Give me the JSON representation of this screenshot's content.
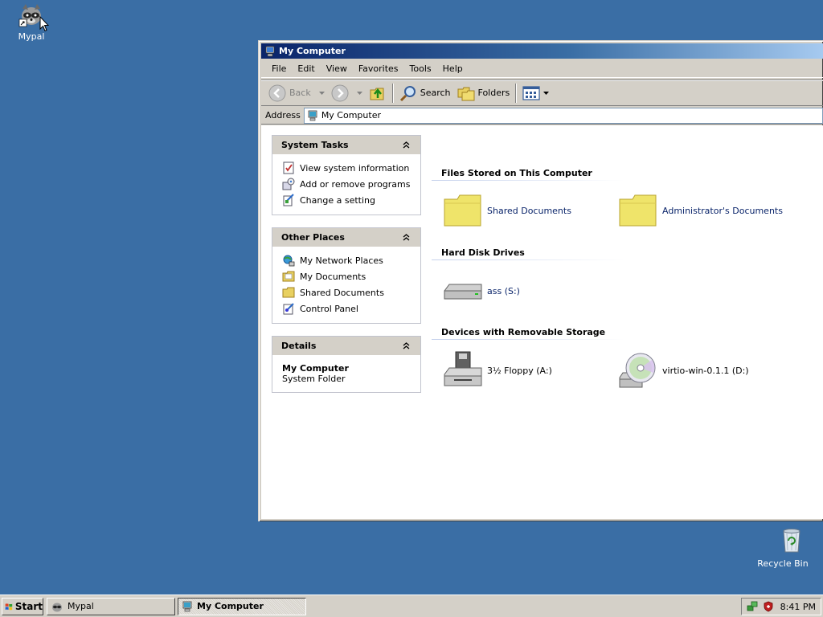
{
  "desktop": {
    "icons": [
      {
        "label": "Mypal",
        "icon": "mypal-raccoon-icon"
      },
      {
        "label": "Recycle Bin",
        "icon": "recycle-bin-icon"
      }
    ],
    "background_color": "#3a6ea5"
  },
  "window": {
    "title": "My Computer",
    "menu": [
      "File",
      "Edit",
      "View",
      "Favorites",
      "Tools",
      "Help"
    ],
    "toolbar": {
      "back_label": "Back",
      "search_label": "Search",
      "folders_label": "Folders"
    },
    "address": {
      "label": "Address",
      "value": "My Computer"
    },
    "system_tasks": {
      "title": "System Tasks",
      "items": [
        {
          "label": "View system information",
          "icon": "system-info-icon"
        },
        {
          "label": "Add or remove programs",
          "icon": "add-remove-programs-icon"
        },
        {
          "label": "Change a setting",
          "icon": "control-setting-icon"
        }
      ]
    },
    "other_places": {
      "title": "Other Places",
      "items": [
        {
          "label": "My Network Places",
          "icon": "network-places-icon"
        },
        {
          "label": "My Documents",
          "icon": "my-documents-icon"
        },
        {
          "label": "Shared Documents",
          "icon": "folder-icon"
        },
        {
          "label": "Control Panel",
          "icon": "control-panel-icon"
        }
      ]
    },
    "details": {
      "title": "Details",
      "name": "My Computer",
      "type": "System Folder"
    },
    "groups": {
      "files": {
        "title": "Files Stored on This Computer",
        "items": [
          "Shared Documents",
          "Administrator's Documents"
        ]
      },
      "hard_disks": {
        "title": "Hard Disk Drives",
        "items": [
          "ass (S:)"
        ]
      },
      "removable": {
        "title": "Devices with Removable Storage",
        "items": [
          "3½ Floppy (A:)",
          "virtio-win-0.1.1 (D:)"
        ]
      }
    }
  },
  "taskbar": {
    "start_label": "Start",
    "tasks": [
      {
        "label": "Mypal",
        "active": false
      },
      {
        "label": "My Computer",
        "active": true
      }
    ],
    "clock": "8:41 PM"
  }
}
